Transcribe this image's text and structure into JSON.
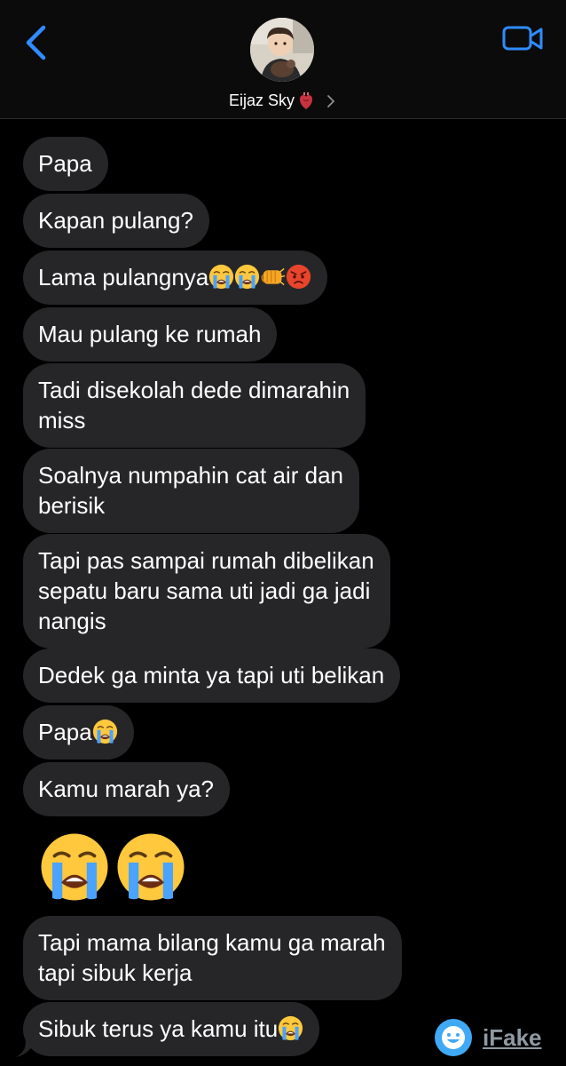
{
  "header": {
    "contact_name": "Eijaz Sky",
    "back_icon": "chevron-left-icon",
    "video_icon": "video-camera-icon",
    "heart_icon": "anatomical-heart-emoji",
    "accent_color": "#2f8cff"
  },
  "messages": [
    {
      "lines": [
        "Papa"
      ]
    },
    {
      "lines": [
        "Kapan pulang?"
      ]
    },
    {
      "lines": [
        "Lama pulangnya"
      ],
      "emojis": [
        "loudly-crying-face",
        "loudly-crying-face",
        "oncoming-fist",
        "pouting-face"
      ]
    },
    {
      "lines": [
        "Mau pulang ke rumah"
      ]
    },
    {
      "lines": [
        "Tadi disekolah dede dimarahin",
        "miss"
      ]
    },
    {
      "lines": [
        "Soalnya numpahin cat air dan",
        "berisik"
      ]
    },
    {
      "lines": [
        "Tapi pas sampai rumah dibelikan",
        "sepatu baru sama uti jadi ga jadi",
        "nangis"
      ]
    },
    {
      "lines": [
        "Dedek ga minta ya tapi uti belikan"
      ]
    },
    {
      "lines": [
        "Papa"
      ],
      "emojis": [
        "loudly-crying-face"
      ]
    },
    {
      "lines": [
        "Kamu marah ya?"
      ]
    },
    {
      "big_emojis": [
        "loudly-crying-face",
        "loudly-crying-face"
      ]
    },
    {
      "lines": [
        "Tapi mama bilang kamu ga marah",
        "tapi sibuk kerja"
      ]
    },
    {
      "lines": [
        "Sibuk terus ya kamu itu"
      ],
      "emojis": [
        "loudly-crying-face"
      ]
    }
  ],
  "watermark": {
    "text": "iFake",
    "icon": "smiley-logo-icon"
  }
}
